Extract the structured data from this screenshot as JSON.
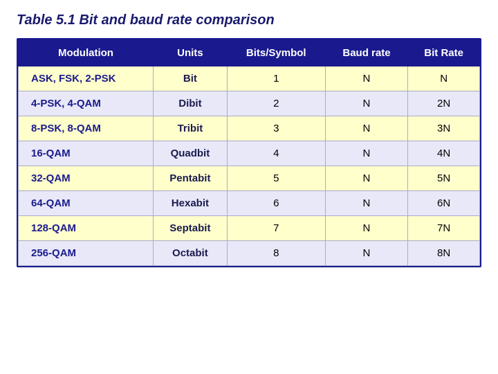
{
  "title": "Table 5.1  Bit and baud rate comparison",
  "table": {
    "headers": [
      "Modulation",
      "Units",
      "Bits/Symbol",
      "Baud rate",
      "Bit Rate"
    ],
    "rows": [
      [
        "ASK, FSK, 2-PSK",
        "Bit",
        "1",
        "N",
        "N"
      ],
      [
        "4-PSK, 4-QAM",
        "Dibit",
        "2",
        "N",
        "2N"
      ],
      [
        "8-PSK, 8-QAM",
        "Tribit",
        "3",
        "N",
        "3N"
      ],
      [
        "16-QAM",
        "Quadbit",
        "4",
        "N",
        "4N"
      ],
      [
        "32-QAM",
        "Pentabit",
        "5",
        "N",
        "5N"
      ],
      [
        "64-QAM",
        "Hexabit",
        "6",
        "N",
        "6N"
      ],
      [
        "128-QAM",
        "Septabit",
        "7",
        "N",
        "7N"
      ],
      [
        "256-QAM",
        "Octabit",
        "8",
        "N",
        "8N"
      ]
    ]
  }
}
